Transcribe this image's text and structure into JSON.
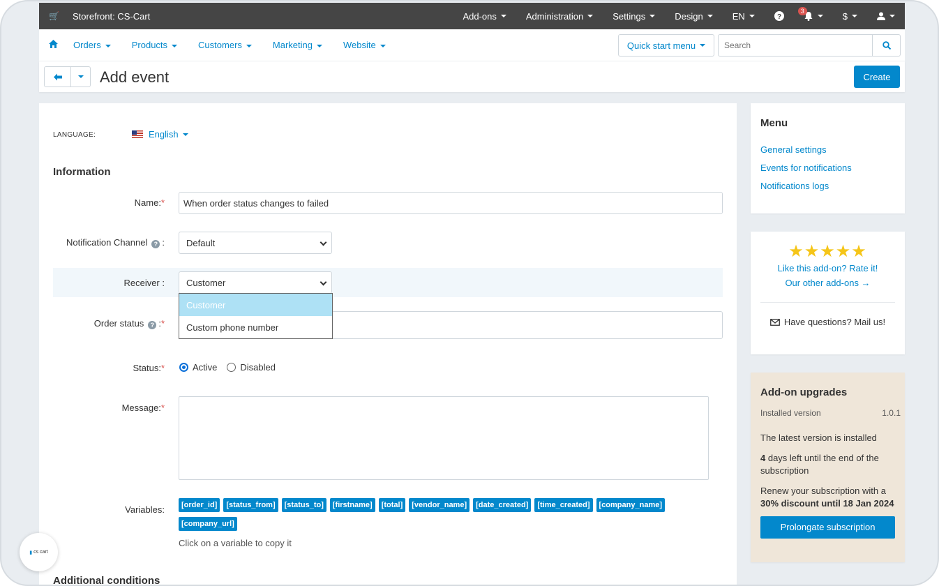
{
  "topbar": {
    "store": "Storefront: CS-Cart",
    "menus": [
      "Add-ons",
      "Administration",
      "Settings",
      "Design",
      "EN"
    ],
    "notifications_count": "3",
    "currency": "$"
  },
  "nav": {
    "items": [
      "Orders",
      "Products",
      "Customers",
      "Marketing",
      "Website"
    ],
    "quick_start": "Quick start menu",
    "search_placeholder": "Search"
  },
  "header": {
    "title": "Add event",
    "create_label": "Create"
  },
  "form": {
    "language_label": "LANGUAGE:",
    "language_value": "English",
    "section_information": "Information",
    "name_label": "Name:",
    "name_value": "When order status changes to failed",
    "channel_label": "Notification Channel",
    "channel_value": "Default",
    "receiver_label": "Receiver :",
    "receiver_value": "Customer",
    "receiver_options": [
      "Customer",
      "Custom phone number"
    ],
    "order_status_label": "Order status",
    "status_label": "Status:",
    "status_active": "Active",
    "status_disabled": "Disabled",
    "message_label": "Message:",
    "variables_label": "Variables:",
    "variables": [
      "[order_id]",
      "[status_from]",
      "[status_to]",
      "[firstname]",
      "[total]",
      "[vendor_name]",
      "[date_created]",
      "[time_created]",
      "[company_name]",
      "[company_url]"
    ],
    "variables_hint": "Click on a variable to copy it",
    "section_additional": "Additional conditions"
  },
  "sidebar": {
    "menu_title": "Menu",
    "menu_links": [
      "General settings",
      "Events for notifications",
      "Notifications logs"
    ],
    "rate_text": "Like this add-on? Rate it!",
    "other_addons": "Our other add-ons →",
    "mail_text": "Have questions? Mail us!",
    "upgrades_title": "Add-on upgrades",
    "installed_label": "Installed version",
    "installed_value": "1.0.1",
    "latest_text": "The latest version is installed",
    "days_left_num": "4",
    "days_left_text": " days left until the end of the subscription",
    "renew_text": "Renew your subscription with a",
    "renew_bold": "30% discount until 18 Jan 2024",
    "prolongate_label": "Prolongate subscription"
  },
  "logo": {
    "text": "cs cart"
  }
}
